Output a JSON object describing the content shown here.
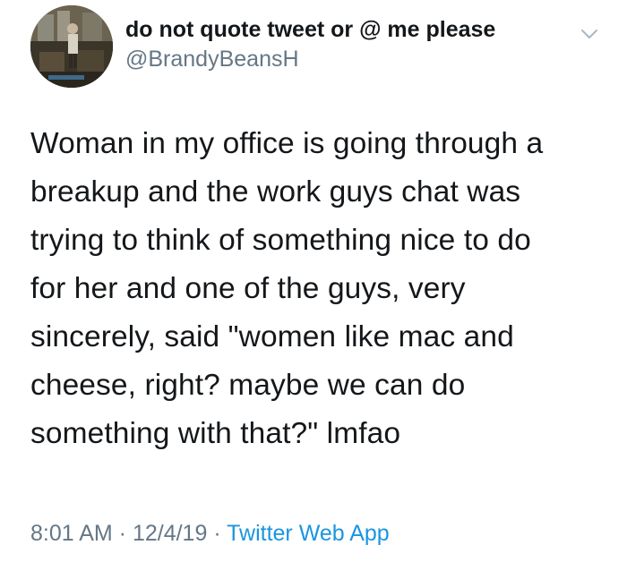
{
  "author": {
    "display_name": "do not quote tweet or @ me please",
    "handle": "@BrandyBeansH"
  },
  "tweet": {
    "text_lines": [
      "Woman in my office is going through a",
      "breakup and the work guys chat was",
      "trying to think of something nice to do",
      "for her and one of the guys, very",
      "sincerely, said \"women like mac and",
      "cheese, right? maybe we can do",
      "something with that?\" lmfao"
    ]
  },
  "meta": {
    "time": "8:01 AM",
    "separator": " · ",
    "date": "12/4/19",
    "source": "Twitter Web App"
  },
  "icons": {
    "menu": "chevron-down-icon"
  },
  "colors": {
    "text": "#14171a",
    "secondary": "#657786",
    "link": "#1b95e0"
  }
}
